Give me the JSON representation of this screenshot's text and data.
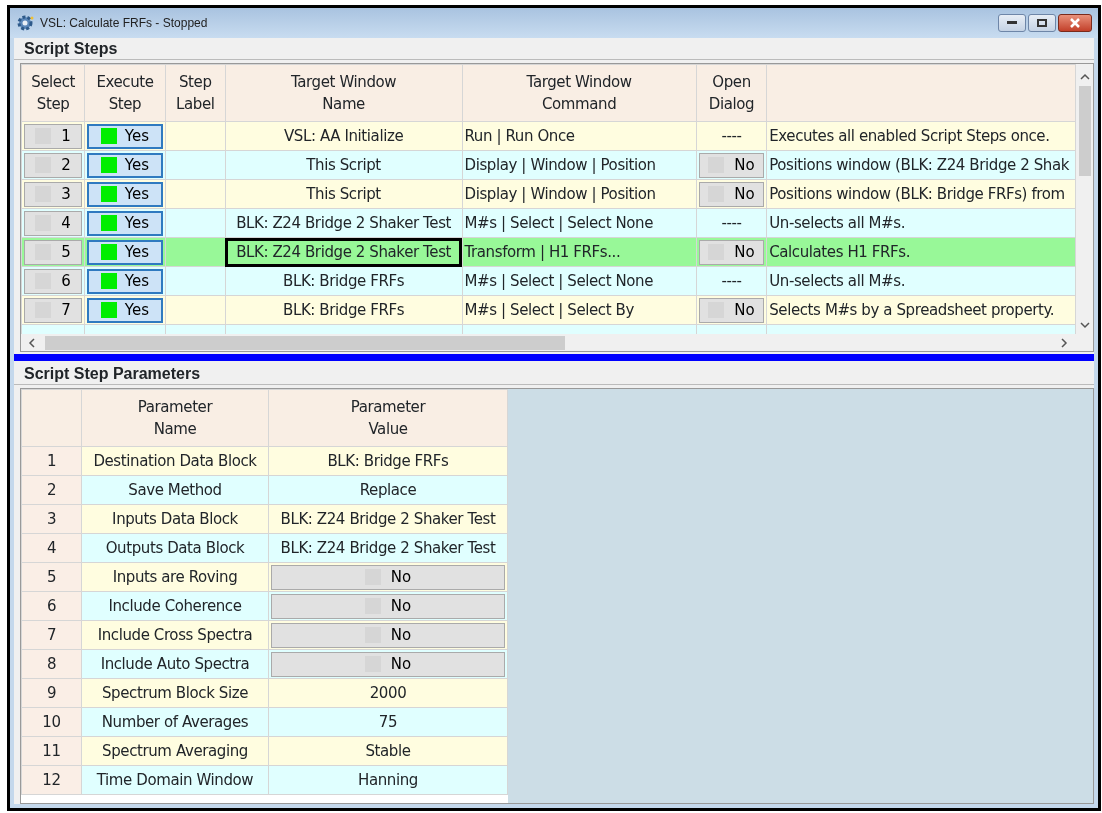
{
  "window": {
    "title": "VSL: Calculate FRFs - Stopped"
  },
  "script_steps": {
    "title": "Script Steps",
    "columns": [
      "Select\nStep",
      "Execute\nStep",
      "Step\nLabel",
      "Target Window\nName",
      "Target Window\nCommand",
      "Open\nDialog"
    ],
    "rows": [
      {
        "step": "1",
        "checked": false,
        "execute": "Yes",
        "execute_on": true,
        "target": "VSL: AA Initialize",
        "command": "Run | Run Once",
        "kind": "text",
        "dialog": "----",
        "description": "Executes all enabled Script Steps once.",
        "selected": false,
        "focused": false
      },
      {
        "step": "2",
        "checked": false,
        "execute": "Yes",
        "execute_on": true,
        "target": "This Script",
        "command": "Display | Window | Position",
        "kind": "button",
        "dialog": "No",
        "description": "Positions window (BLK: Z24 Bridge 2 Shak",
        "selected": false,
        "focused": false
      },
      {
        "step": "3",
        "checked": false,
        "execute": "Yes",
        "execute_on": true,
        "target": "This Script",
        "command": "Display | Window | Position",
        "kind": "button",
        "dialog": "No",
        "description": "Positions window (BLK: Bridge FRFs) from",
        "selected": false,
        "focused": false
      },
      {
        "step": "4",
        "checked": false,
        "execute": "Yes",
        "execute_on": true,
        "target": "BLK: Z24 Bridge 2 Shaker Test",
        "command": "M#s | Select | Select None",
        "kind": "text",
        "dialog": "----",
        "description": "Un-selects all M#s.",
        "selected": false,
        "focused": false
      },
      {
        "step": "5",
        "checked": false,
        "execute": "Yes",
        "execute_on": true,
        "target": "BLK: Z24 Bridge 2 Shaker Test",
        "command": "Transform | H1 FRFs...",
        "kind": "button",
        "dialog": "No",
        "description": "Calculates H1 FRFs.",
        "selected": true,
        "focused": true
      },
      {
        "step": "6",
        "checked": false,
        "execute": "Yes",
        "execute_on": true,
        "target": "BLK: Bridge FRFs",
        "command": "M#s | Select | Select None",
        "kind": "text",
        "dialog": "----",
        "description": "Un-selects all M#s.",
        "selected": false,
        "focused": false
      },
      {
        "step": "7",
        "checked": false,
        "execute": "Yes",
        "execute_on": true,
        "target": "BLK: Bridge FRFs",
        "command": "M#s | Select | Select By",
        "kind": "button",
        "dialog": "No",
        "description": "Selects M#s by a Spreadsheet property.",
        "selected": false,
        "focused": false
      }
    ]
  },
  "parameters": {
    "title": "Script Step Parameters",
    "columns": [
      "Parameter\nName",
      "Parameter\nValue"
    ],
    "rows": [
      {
        "index": "1",
        "name": "Destination Data Block",
        "kind": "text",
        "value": "BLK: Bridge FRFs"
      },
      {
        "index": "2",
        "name": "Save Method",
        "kind": "text",
        "value": "Replace"
      },
      {
        "index": "3",
        "name": "Inputs Data Block",
        "kind": "text",
        "value": "BLK: Z24 Bridge 2 Shaker Test"
      },
      {
        "index": "4",
        "name": "Outputs Data Block",
        "kind": "text",
        "value": "BLK: Z24 Bridge 2 Shaker Test"
      },
      {
        "index": "5",
        "name": "Inputs are Roving",
        "kind": "toggle",
        "value": "No"
      },
      {
        "index": "6",
        "name": "Include Coherence",
        "kind": "toggle",
        "value": "No"
      },
      {
        "index": "7",
        "name": "Include Cross Spectra",
        "kind": "toggle",
        "value": "No"
      },
      {
        "index": "8",
        "name": "Include Auto Spectra",
        "kind": "toggle",
        "value": "No"
      },
      {
        "index": "9",
        "name": "Spectrum Block Size",
        "kind": "text",
        "value": "2000"
      },
      {
        "index": "10",
        "name": "Number of Averages",
        "kind": "text",
        "value": "75"
      },
      {
        "index": "11",
        "name": "Spectrum Averaging",
        "kind": "text",
        "value": "Stable"
      },
      {
        "index": "12",
        "name": "Time Domain Window",
        "kind": "text",
        "value": "Hanning"
      }
    ]
  }
}
